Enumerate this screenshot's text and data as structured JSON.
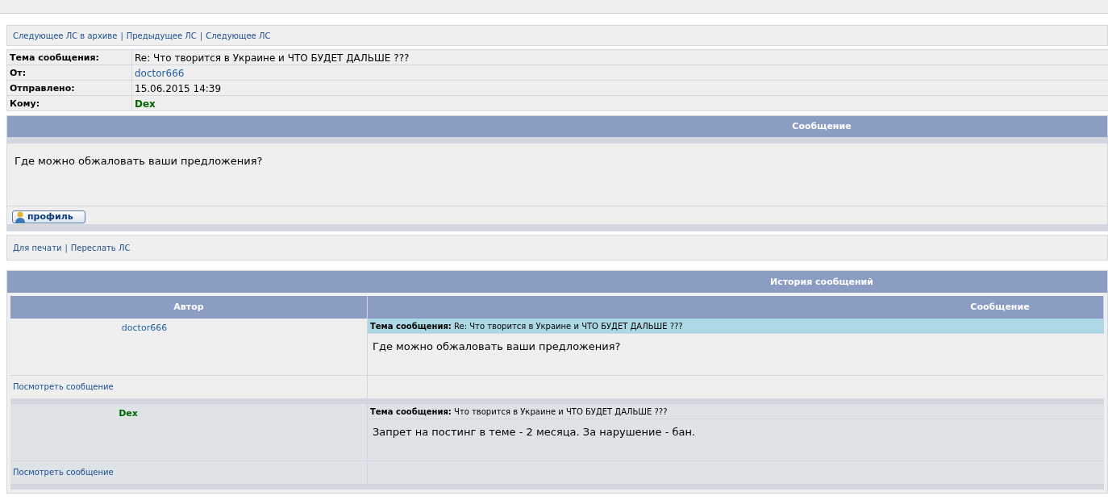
{
  "link_separator": "|",
  "nav_links": [
    "Следующее ЛС в архиве",
    "Предыдущее ЛС",
    "Следующее ЛС"
  ],
  "details": [
    {
      "label": "Тема сообщения:",
      "value": "Re: Что творится в Украине и ЧТО БУДЕТ ДАЛЬШЕ ???",
      "kind": "text"
    },
    {
      "label": "От:",
      "value": "doctor666",
      "kind": "user"
    },
    {
      "label": "Отправлено:",
      "value": "15.06.2015 14:39",
      "kind": "text"
    },
    {
      "label": "Кому:",
      "value": "Dex",
      "kind": "moderator"
    }
  ],
  "message": {
    "header": "Сообщение",
    "body": "Где можно обжаловать ваши предложения?",
    "profile_button": "профиль"
  },
  "actions": [
    "Для печати",
    "Переслать ЛС"
  ],
  "history": {
    "title": "История сообщений",
    "columns": [
      "Автор",
      "Сообщение"
    ],
    "posts": [
      {
        "author": "doctor666",
        "kind": "user",
        "subject_label": "Тема сообщения:",
        "subject": "Re: Что творится в Украине и ЧТО БУДЕТ ДАЛЬШЕ ???",
        "body": "Где можно обжаловать ваши предложения?",
        "view_link": "Посмотреть сообщение",
        "highlighted": true
      },
      {
        "author": "Dex",
        "kind": "moderator",
        "subject_label": "Тема сообщения:",
        "subject": "Что творится в Украине и ЧТО БУДЕТ ДАЛЬШЕ ???",
        "body": "Запрет на постинг в теме - 2 месяца. За нарушение - бан.",
        "view_link": "Посмотреть сообщение",
        "highlighted": false
      }
    ]
  }
}
